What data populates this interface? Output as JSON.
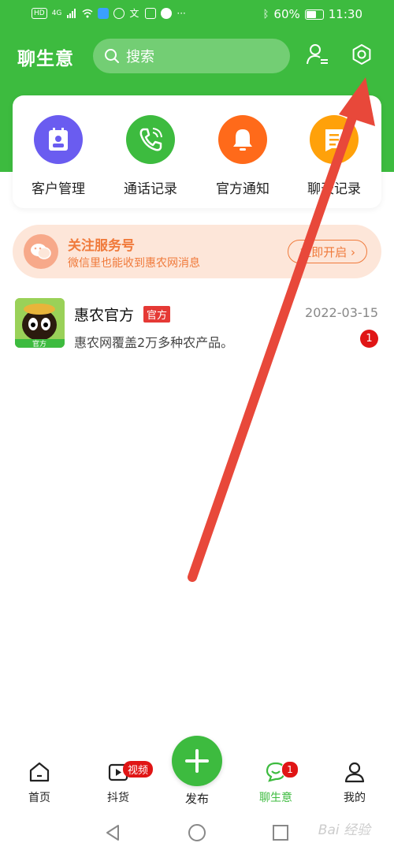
{
  "status_bar": {
    "hd": "HD",
    "net": "4G",
    "battery": "60%",
    "time": "11:30"
  },
  "header": {
    "title": "聊生意",
    "search_placeholder": "搜索"
  },
  "quick_actions": [
    {
      "label": "客户管理",
      "icon": "contacts-icon",
      "color": "#6a5cf0"
    },
    {
      "label": "通话记录",
      "icon": "phone-icon",
      "color": "#3dbb3f"
    },
    {
      "label": "官方通知",
      "icon": "bell-icon",
      "color": "#ff6a1a"
    },
    {
      "label": "聊天记录",
      "icon": "chat-record-icon",
      "color": "#ffa10a"
    }
  ],
  "banner": {
    "title": "关注服务号",
    "subtitle": "微信里也能收到惠农网消息",
    "button": "立即开启"
  },
  "chat": {
    "name": "惠农官方",
    "tag": "官方",
    "date": "2022-03-15",
    "preview": "惠农网覆盖2万多种农产品。",
    "unread": "1",
    "avatar_label": "官方"
  },
  "nav": {
    "home": "首页",
    "doushop": "抖货",
    "doushop_badge": "视频",
    "publish": "发布",
    "chat": "聊生意",
    "chat_badge": "1",
    "me": "我的"
  },
  "watermark": "Bai 经验",
  "colors": {
    "brand": "#3dbb3f",
    "accent_orange": "#f07a3b",
    "badge_red": "#e01515"
  }
}
